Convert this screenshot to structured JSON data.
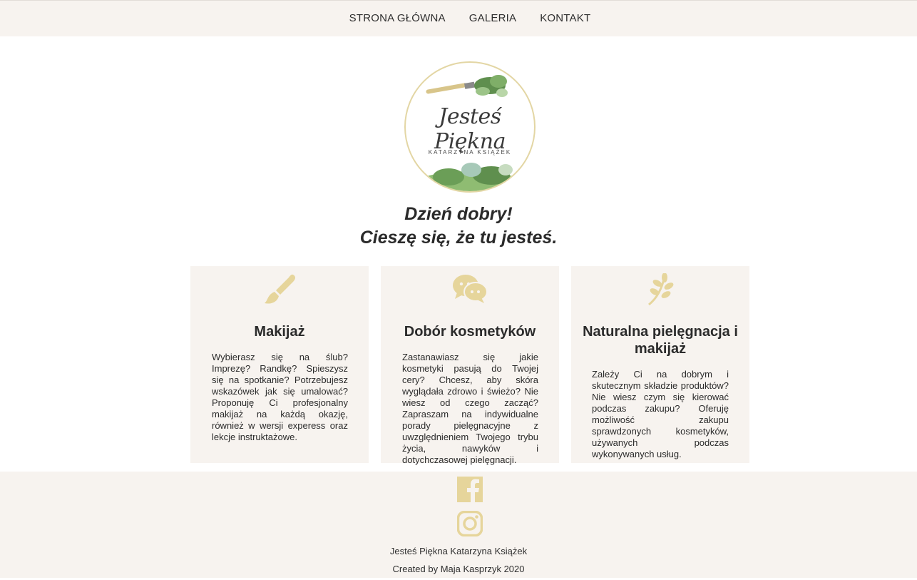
{
  "nav": {
    "items": [
      {
        "label": "STRONA GŁÓWNA"
      },
      {
        "label": "GALERIA"
      },
      {
        "label": "KONTAKT"
      }
    ]
  },
  "logo": {
    "script": "Jesteś Piękna",
    "subtitle": "KATARZYNA KSIĄŻEK"
  },
  "greeting": {
    "line1": "Dzień dobry!",
    "line2": "Cieszę się, że tu jesteś."
  },
  "cards": [
    {
      "icon": "paintbrush-icon",
      "title": "Makijaż",
      "text": "Wybierasz się na ślub? Imprezę? Randkę? Spieszysz się na spotkanie? Potrzebujesz wskazówek jak się umalować? Proponuję Ci profesjonalny makijaż na każdą okazję, również w wersji experess oraz lekcje instruktażowe."
    },
    {
      "icon": "chat-bubbles-icon",
      "title": "Dobór kosmetyków",
      "text": "Zastanawiasz się jakie kosmetyki pasują do Twojej cery? Chcesz, aby skóra wyglądała zdrowo i świeżo? Nie wiesz od czego zacząć? Zapraszam na indywidualne porady pielęgnacyjne z uwzględnieniem Twojego trybu życia, nawyków i dotychczasowej pielęgnacji."
    },
    {
      "icon": "leaf-branch-icon",
      "title": "Naturalna pielęgnacja i makijaż",
      "text": "Zależy Ci na dobrym i skutecznym składzie produktów? Nie wiesz czym się kierować podczas zakupu? Oferuję możliwość zakupu sprawdzonych kosmetyków, używanych podczas wykonywanych usług."
    }
  ],
  "footer": {
    "business": "Jesteś Piękna Katarzyna Książek",
    "credit": "Created by Maja Kasprzyk 2020",
    "icons": [
      "facebook-icon",
      "instagram-icon"
    ]
  },
  "colors": {
    "accent": "#e6d59b",
    "panel": "#f7f3ef",
    "text": "#2b2b2b"
  }
}
